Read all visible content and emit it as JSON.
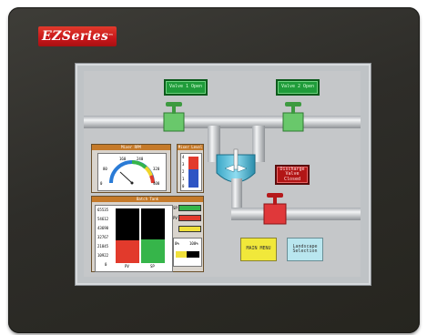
{
  "device": {
    "brand": "EZSeries",
    "brand_mark": "™"
  },
  "buttons": {
    "valve1": "Valve 1 Open",
    "valve2": "Valve 2 Open",
    "discharge": "Discharge Valve Closed",
    "main_menu": "MAIN MENU",
    "landscape": "Landscape Selection"
  },
  "panels": {
    "mixer_rpm": {
      "title": "Mixer RPM",
      "ticks": [
        "0",
        "80",
        "160",
        "240",
        "320",
        "400"
      ]
    },
    "mixer_level": {
      "title": "Mixer Level",
      "ticks": [
        "4",
        "3",
        "2",
        "1",
        "0"
      ],
      "level": 0.6
    },
    "batch_tank": {
      "title": "Batch Tank",
      "y_ticks": [
        "65535",
        "54612",
        "43690",
        "32767",
        "21845",
        "10922",
        "0"
      ],
      "bar_labels": [
        "PV",
        "SP"
      ],
      "bar_values": [
        0.42,
        0.44
      ],
      "indicator_labels": [
        "SP",
        "PV"
      ],
      "percent_labels": [
        "0%",
        "100%"
      ]
    }
  },
  "colors": {
    "valve_button": "#1f9c3a",
    "pipe": "#d8dbde",
    "valve_green": "#69c86b",
    "valve_red": "#e0383a",
    "panel_title": "#c57a2a",
    "main_menu_btn": "#f1e83a",
    "landscape_btn": "#b9e6ef"
  }
}
